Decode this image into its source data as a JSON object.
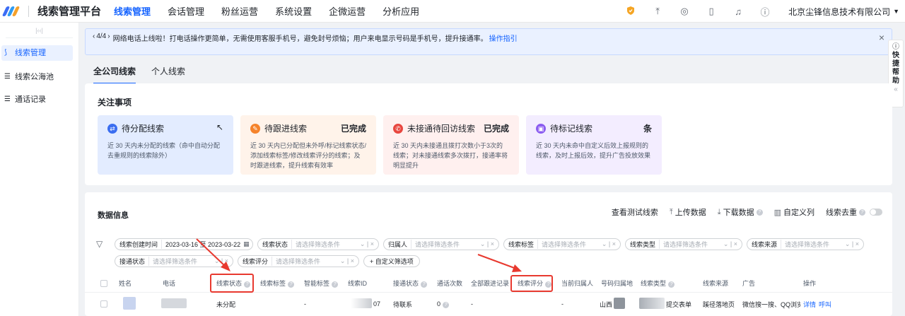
{
  "app": {
    "title": "线索管理平台",
    "company": "北京尘锋信息技术有限公司"
  },
  "nav": [
    "线索管理",
    "会话管理",
    "粉丝运营",
    "系统设置",
    "企微运营",
    "分析应用"
  ],
  "sidebar": {
    "items": [
      {
        "label": "线索管理"
      },
      {
        "label": "线索公海池"
      },
      {
        "label": "通话记录"
      }
    ]
  },
  "notice": {
    "page": "4/4",
    "text": "网络电话上线啦！打电话操作更简单，无需使用客服手机号，避免封号烦恼；用户来电显示号码是手机号，提升接通率。",
    "link": "操作指引"
  },
  "helper": {
    "label": "快捷帮助"
  },
  "tabs": [
    "全公司线索",
    "个人线索"
  ],
  "attention": {
    "title": "关注事项",
    "cards": [
      {
        "title": "待分配线索",
        "value": "",
        "desc": "近 30 天内未分配的线索（命中自动分配去重规则的线索除外）",
        "color": "#3a6df0",
        "bg": "#e3ecff"
      },
      {
        "title": "待跟进线索",
        "value": "已完成",
        "desc": "近 30 天内已分配但未外呼/标记线索状态/添加线索标签/修改线索评分的线索；及时跟进线索，提升线索有效率",
        "color": "#f5832b",
        "bg": "#fff3ea"
      },
      {
        "title": "未接通待回访线索",
        "value": "已完成",
        "desc": "近 30 天内未接通且拨打次数小于3次的线索；对未接通线索多次拨打，接通率将明显提升",
        "color": "#e8463f",
        "bg": "#fff0ef"
      },
      {
        "title": "待标记线索",
        "value": "条",
        "desc": "近 30 天内未命中自定义后效上报规则的线索，及时上报后效，提升广告投放效果",
        "color": "#8b5cf0",
        "bg": "#f3edff"
      }
    ]
  },
  "data_section": {
    "title": "数据信息",
    "actions": [
      "查看测试线索",
      "上传数据",
      "下载数据",
      "自定义列",
      "线索去重"
    ]
  },
  "filters": {
    "row1": [
      {
        "label": "线索创建时间",
        "value": "2023-03-16 至 2023-03-22"
      },
      {
        "label": "线索状态",
        "placeholder": "请选择筛选条件"
      },
      {
        "label": "归属人",
        "placeholder": "请选择筛选条件"
      },
      {
        "label": "线索标签",
        "placeholder": "请选择筛选条件"
      },
      {
        "label": "线索类型",
        "placeholder": "请选择筛选条件"
      },
      {
        "label": "线索来源",
        "placeholder": "请选择筛选条件"
      }
    ],
    "row2": [
      {
        "label": "接通状态",
        "placeholder": "请选择筛选条件"
      },
      {
        "label": "线索评分",
        "placeholder": "请选择筛选条件"
      }
    ],
    "add": "+ 自定义筛选项"
  },
  "table": {
    "columns": [
      "姓名",
      "电话",
      "线索状态",
      "线索标签",
      "智能标签",
      "线索ID",
      "接通状态",
      "通话次数",
      "全部跟进记录",
      "线索评分",
      "当前归属人",
      "号码归属地",
      "线索类型",
      "线索来源",
      "广告",
      "操作"
    ],
    "rows": [
      {
        "status": "未分配",
        "tag": "-",
        "id_tail": "07",
        "connect": "待联系",
        "calls": "0",
        "score": "-",
        "location": "山西",
        "type": "提交表单",
        "source": "蹊径落地页",
        "ad": "微信搜一搜、QQ浏览器",
        "ops": [
          "详情",
          "呼叫"
        ]
      }
    ]
  }
}
